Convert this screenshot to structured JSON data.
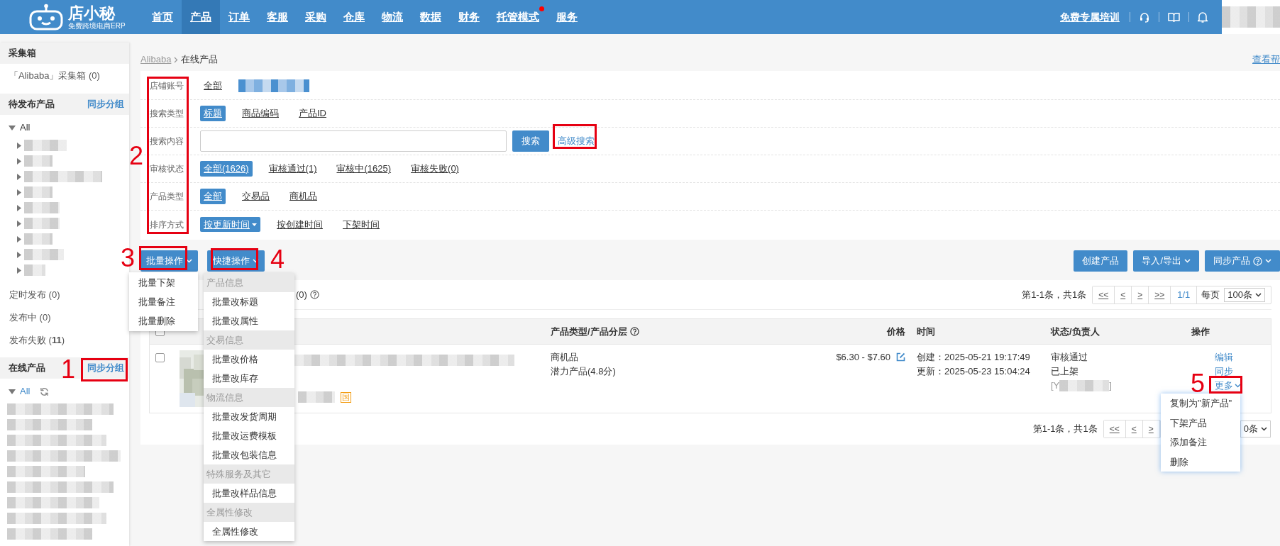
{
  "app": {
    "name": "店小秘",
    "tagline": "免费跨境电商ERP"
  },
  "nav": [
    {
      "label": "首页",
      "selected": false,
      "notice": false
    },
    {
      "label": "产品",
      "selected": true,
      "notice": false
    },
    {
      "label": "订单",
      "selected": false,
      "notice": false
    },
    {
      "label": "客服",
      "selected": false,
      "notice": false
    },
    {
      "label": "采购",
      "selected": false,
      "notice": false
    },
    {
      "label": "仓库",
      "selected": false,
      "notice": false
    },
    {
      "label": "物流",
      "selected": false,
      "notice": false
    },
    {
      "label": "数据",
      "selected": false,
      "notice": false
    },
    {
      "label": "财务",
      "selected": false,
      "notice": false
    },
    {
      "label": "托管模式",
      "selected": false,
      "notice": true
    },
    {
      "label": "服务",
      "selected": false,
      "notice": false
    }
  ],
  "header_links": {
    "training": "免费专属培训"
  },
  "breadcrumb": {
    "parent": "Alibaba",
    "current": "在线产品",
    "help": "查看帮"
  },
  "sidebar": [
    {
      "kind": "header",
      "label": "采集箱"
    },
    {
      "kind": "item",
      "label": "「Alibaba」采集箱 (0)"
    },
    {
      "kind": "header",
      "label": "待发布产品",
      "action": "同步分组"
    },
    {
      "kind": "tree",
      "label": "All",
      "expanded": true,
      "selected": false,
      "refresh": false
    },
    {
      "kind": "item",
      "label": "定时发布 (0)"
    },
    {
      "kind": "item",
      "label": "发布中 (0)"
    },
    {
      "kind": "item",
      "label": "发布失败 (**11**)"
    },
    {
      "kind": "header",
      "label": "在线产品",
      "action": "同步分组"
    },
    {
      "kind": "tree",
      "label": "All",
      "expanded": true,
      "selected": true,
      "refresh": true
    }
  ],
  "filters": [
    {
      "kind": "options",
      "label": "店铺账号",
      "masked_account": true,
      "options": [
        {
          "text": "全部",
          "selected": false,
          "dropdown": false
        }
      ]
    },
    {
      "kind": "options",
      "label": "搜索类型",
      "options": [
        {
          "text": "标题",
          "selected": true,
          "dropdown": false
        },
        {
          "text": "商品编码",
          "selected": false,
          "dropdown": false
        },
        {
          "text": "产品ID",
          "selected": false,
          "dropdown": false
        }
      ]
    },
    {
      "kind": "search",
      "label": "搜索内容",
      "button": "搜索",
      "link": "高级搜索"
    },
    {
      "kind": "options",
      "label": "审核状态",
      "options": [
        {
          "text": "全部(1626)",
          "selected": true,
          "dropdown": false
        },
        {
          "text": "审核通过(1)",
          "selected": false,
          "dropdown": false
        },
        {
          "text": "审核中(1625)",
          "selected": false,
          "dropdown": false
        },
        {
          "text": "审核失败(0)",
          "selected": false,
          "dropdown": false
        }
      ]
    },
    {
      "kind": "options",
      "label": "产品类型",
      "options": [
        {
          "text": "全部",
          "selected": true,
          "dropdown": false
        },
        {
          "text": "交易品",
          "selected": false,
          "dropdown": false
        },
        {
          "text": "商机品",
          "selected": false,
          "dropdown": false
        }
      ]
    },
    {
      "kind": "options",
      "label": "排序方式",
      "options": [
        {
          "text": "按更新时间",
          "selected": true,
          "dropdown": true
        },
        {
          "text": "按创建时间",
          "selected": false,
          "dropdown": false
        },
        {
          "text": "下架时间",
          "selected": false,
          "dropdown": false
        }
      ]
    }
  ],
  "toolbar": {
    "left": [
      {
        "label": "批量操作",
        "caret": true,
        "help": false
      },
      {
        "label": "快捷操作",
        "caret": true,
        "help": false
      }
    ],
    "right": [
      {
        "label": "创建产品",
        "caret": false,
        "help": false
      },
      {
        "label": "导入/导出",
        "caret": true,
        "help": false
      },
      {
        "label": "同步产品",
        "caret": true,
        "help": true
      }
    ]
  },
  "list": {
    "tab_fragment": "(0)",
    "pager": {
      "info": "第1-1条，共1条",
      "buttons": [
        "<<",
        "<",
        ">",
        ">>"
      ],
      "page": "1/1",
      "per_page_label": "每页",
      "per_page": "100条"
    },
    "columns": [
      {
        "label": "产品类型/产品分层",
        "help": true
      },
      {
        "label": "价格",
        "help": false
      },
      {
        "label": "时间",
        "help": false
      },
      {
        "label": "状态/负责人",
        "help": false
      },
      {
        "label": "操作",
        "help": false
      }
    ],
    "header_checked": false,
    "rows": [
      {
        "checked": false,
        "tag": "国",
        "type": "商机品",
        "tier": "潜力产品(4.8分)",
        "price": "$6.30 - $7.60",
        "created": "创建：2025-05-21 19:17:49",
        "updated": "更新：2025-05-23 15:04:24",
        "status": "审核通过",
        "listing": "已上架",
        "owner_prefix": "[Y",
        "owner_suffix": "]",
        "actions": [
          "编辑",
          "同步",
          "更多"
        ]
      }
    ],
    "bottom_pager": {
      "info": "第1-1条，共1条",
      "buttons": [
        "<<",
        "<",
        ">"
      ],
      "per_page": "0条"
    }
  },
  "menus": {
    "batch": [
      "批量下架",
      "批量备注",
      "批量删除"
    ],
    "quick": [
      {
        "kind": "group",
        "label": "产品信息"
      },
      {
        "kind": "item",
        "label": "批量改标题"
      },
      {
        "kind": "item",
        "label": "批量改属性"
      },
      {
        "kind": "group",
        "label": "交易信息"
      },
      {
        "kind": "item",
        "label": "批量改价格"
      },
      {
        "kind": "item",
        "label": "批量改库存"
      },
      {
        "kind": "group",
        "label": "物流信息"
      },
      {
        "kind": "item",
        "label": "批量改发货周期"
      },
      {
        "kind": "item",
        "label": "批量改运费模板"
      },
      {
        "kind": "item",
        "label": "批量改包装信息"
      },
      {
        "kind": "group",
        "label": "特殊服务及其它"
      },
      {
        "kind": "item",
        "label": "批量改样品信息"
      },
      {
        "kind": "group",
        "label": "全属性修改"
      },
      {
        "kind": "item",
        "label": "全属性修改"
      }
    ],
    "more": [
      "复制为\"新产品\"",
      "下架产品",
      "添加备注",
      "删除"
    ]
  },
  "annotations": [
    {
      "label": "1"
    },
    {
      "label": "2"
    },
    {
      "label": "3"
    },
    {
      "label": "4"
    },
    {
      "label": "5"
    }
  ]
}
